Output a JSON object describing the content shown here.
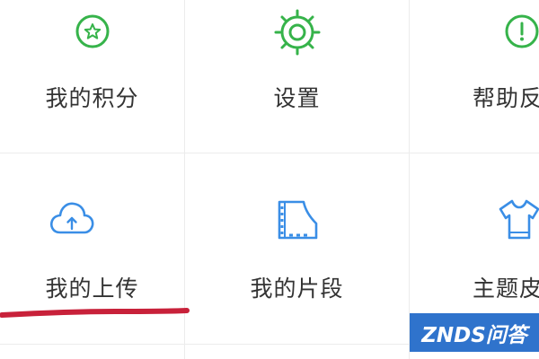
{
  "colors": {
    "green_icon": "#36b34a",
    "blue_icon": "#3a8ee6",
    "label_text": "#333333",
    "divider": "#ececec",
    "annotation_stroke": "#c8213a",
    "watermark_bg": "#2f73cc"
  },
  "menu": {
    "row1": [
      {
        "label": "我的积分",
        "icon": "star-badge-icon"
      },
      {
        "label": "设置",
        "icon": "gear-icon"
      },
      {
        "label": "帮助反",
        "icon": "exclamation-icon"
      }
    ],
    "row2": [
      {
        "label": "我的上传",
        "icon": "cloud-upload-icon"
      },
      {
        "label": "我的片段",
        "icon": "film-clip-icon"
      },
      {
        "label": "主题皮",
        "icon": "tshirt-icon"
      }
    ]
  },
  "watermark": {
    "text": "ZNDS问答"
  }
}
